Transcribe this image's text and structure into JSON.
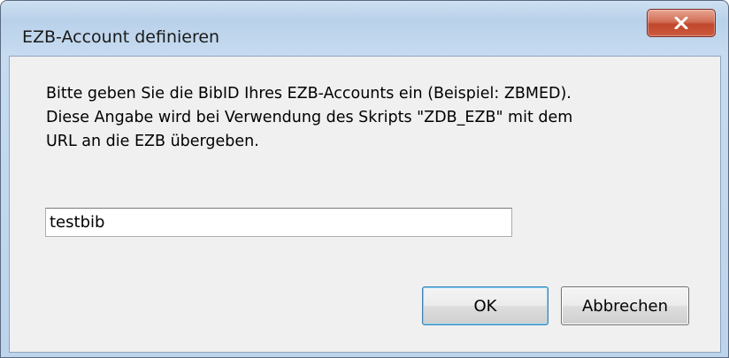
{
  "window": {
    "title": "EZB-Account definieren"
  },
  "title_bar": {
    "close_icon": "close-x-icon",
    "close_color": "#c0472c"
  },
  "message": {
    "lines": [
      "Bitte geben Sie die BibID Ihres EZB-Accounts ein (Beispiel: ZBMED).",
      "Diese Angabe wird bei Verwendung des Skripts \"ZDB_EZB\" mit dem",
      "URL an die EZB übergeben."
    ]
  },
  "input": {
    "value": "testbib"
  },
  "buttons": {
    "ok_label": "OK",
    "cancel_label": "Abbrechen"
  }
}
